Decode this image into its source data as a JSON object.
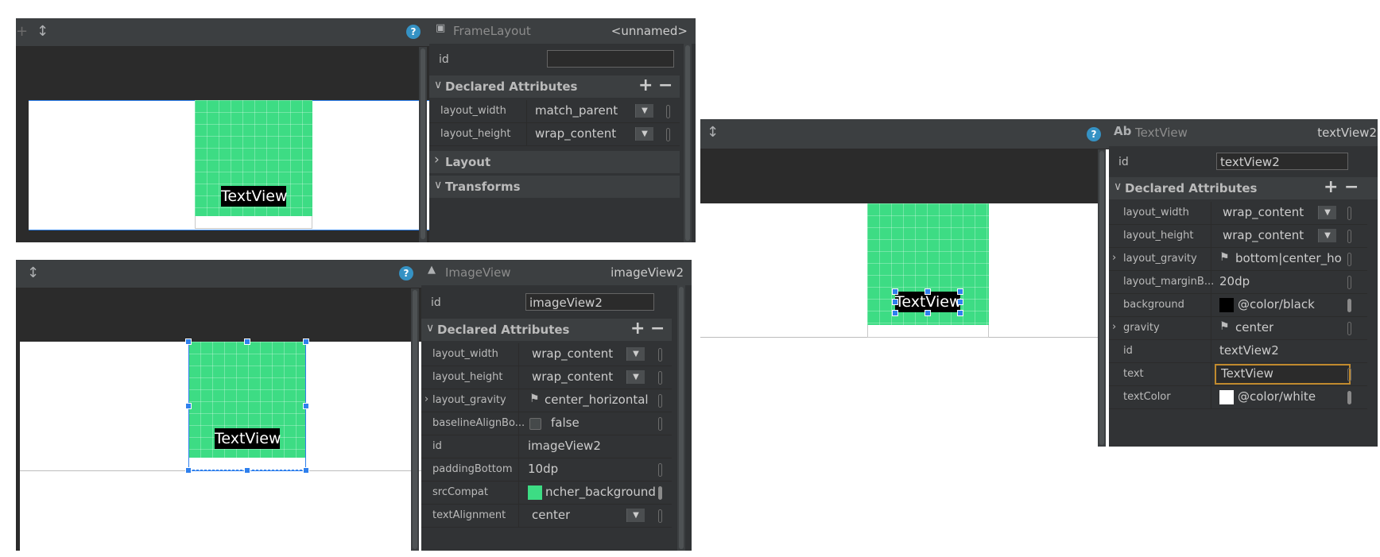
{
  "panel1": {
    "class_name": "FrameLayout",
    "element_name": "<unnamed>",
    "id_label": "id",
    "id_value": "",
    "section_declared": "Declared Attributes",
    "rows": [
      {
        "label": "layout_width",
        "value": "match_parent"
      },
      {
        "label": "layout_height",
        "value": "wrap_content"
      }
    ],
    "section_layout": "Layout",
    "section_transforms": "Transforms",
    "textview_text": "TextView"
  },
  "panel2": {
    "class_name": "ImageView",
    "element_name": "imageView2",
    "id_label": "id",
    "id_value": "imageView2",
    "section_declared": "Declared Attributes",
    "rows": [
      {
        "label": "layout_width",
        "value": "wrap_content"
      },
      {
        "label": "layout_height",
        "value": "wrap_content"
      },
      {
        "label": "layout_gravity",
        "value": "center_horizontal"
      },
      {
        "label": "baselineAlignBo...",
        "value": "false"
      },
      {
        "label": "id",
        "value": "imageView2"
      },
      {
        "label": "paddingBottom",
        "value": "10dp"
      },
      {
        "label": "srcCompat",
        "value": "ncher_background"
      },
      {
        "label": "textAlignment",
        "value": "center"
      }
    ],
    "textview_text": "TextView"
  },
  "panel3": {
    "class_icon": "Ab",
    "class_name": "TextView",
    "element_name": "textView2",
    "id_label": "id",
    "id_value": "textView2",
    "section_declared": "Declared Attributes",
    "rows": [
      {
        "label": "layout_width",
        "value": "wrap_content"
      },
      {
        "label": "layout_height",
        "value": "wrap_content"
      },
      {
        "label": "layout_gravity",
        "value": "bottom|center_hori"
      },
      {
        "label": "layout_marginB...",
        "value": "20dp"
      },
      {
        "label": "background",
        "value": "@color/black"
      },
      {
        "label": "gravity",
        "value": "center"
      },
      {
        "label": "id",
        "value": "textView2"
      },
      {
        "label": "text",
        "value": "TextView"
      },
      {
        "label": "textColor",
        "value": "@color/white"
      }
    ],
    "textview_text": "TextView"
  },
  "colors": {
    "android_green": "#3ddc84",
    "selection_blue": "#2f80ed",
    "help_blue": "#3592c4",
    "focus_orange": "#c08a2e",
    "swatch_black": "#000000",
    "swatch_white": "#ffffff"
  },
  "icons": {
    "help": "?",
    "resize": "↕",
    "plus": "+",
    "minus": "−",
    "chevron_down": "∨",
    "chevron_right": "›",
    "dropdown": "▼",
    "flag": "⚑"
  }
}
